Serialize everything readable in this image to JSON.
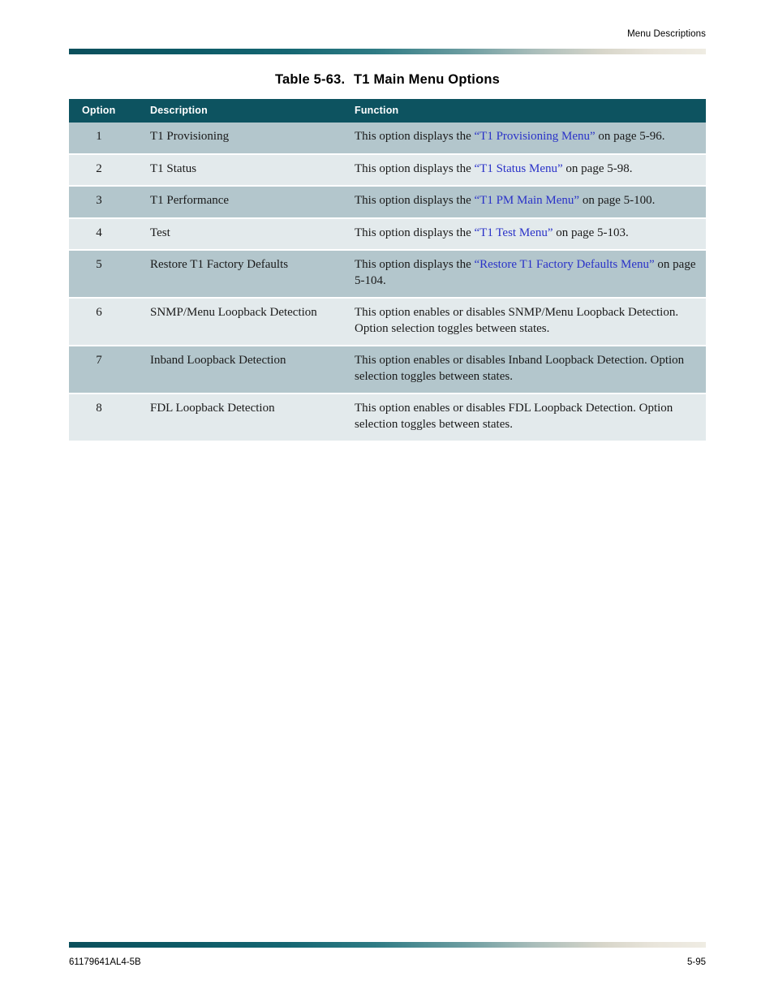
{
  "header": {
    "running_head": "Menu Descriptions"
  },
  "table": {
    "title_number": "Table 5-63.",
    "title_text": "T1 Main Menu Options",
    "columns": {
      "option": "Option",
      "description": "Description",
      "function": "Function"
    },
    "rows": [
      {
        "option": "1",
        "description": "T1 Provisioning",
        "function_pre": "This option displays the ",
        "function_link": "“T1 Provisioning Menu”",
        "function_post": " on page 5-96."
      },
      {
        "option": "2",
        "description": "T1 Status",
        "function_pre": "This option displays the ",
        "function_link": "“T1 Status Menu”",
        "function_post": " on page 5-98."
      },
      {
        "option": "3",
        "description": "T1 Performance",
        "function_pre": "This option displays the ",
        "function_link": "“T1 PM Main Menu”",
        "function_post": " on page 5-100."
      },
      {
        "option": "4",
        "description": "Test",
        "function_pre": "This option displays the ",
        "function_link": "“T1 Test Menu”",
        "function_post": " on page 5-103."
      },
      {
        "option": "5",
        "description": "Restore T1 Factory Defaults",
        "function_pre": "This option displays the ",
        "function_link": "“Restore T1 Factory Defaults Menu”",
        "function_post": " on page 5-104."
      },
      {
        "option": "6",
        "description": "SNMP/Menu Loopback Detection",
        "function_pre": "This option enables or disables SNMP/Menu Loopback Detection. Option selection toggles between states.",
        "function_link": "",
        "function_post": ""
      },
      {
        "option": "7",
        "description": "Inband Loopback Detection",
        "function_pre": "This option enables or disables Inband Loopback Detection. Option selection toggles between states.",
        "function_link": "",
        "function_post": ""
      },
      {
        "option": "8",
        "description": "FDL Loopback Detection",
        "function_pre": "This option enables or disables FDL Loopback Detection. Option selection toggles between states.",
        "function_link": "",
        "function_post": ""
      }
    ]
  },
  "footer": {
    "document_number": "61179641AL4-5B",
    "page_number": "5-95"
  },
  "colors": {
    "header_teal": "#0d5360",
    "row_dark": "#b3c6cc",
    "row_light": "#e3eaec",
    "link_blue": "#2a32c8",
    "rule_start": "#0b4f5c",
    "rule_end": "#efece3"
  }
}
